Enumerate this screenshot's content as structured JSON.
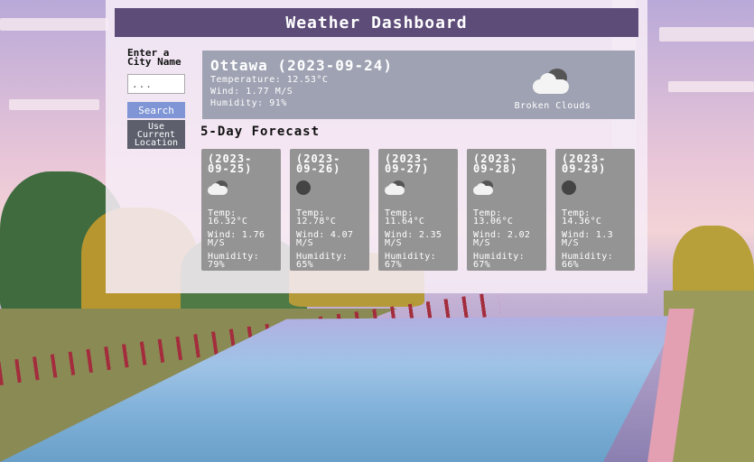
{
  "header": {
    "title": "Weather Dashboard"
  },
  "search": {
    "label": "Enter a City Name",
    "placeholder": "...",
    "search_button": "Search",
    "location_button": "Use Current Location"
  },
  "current": {
    "heading": "Ottawa (2023-09-24)",
    "temperature": "Temperature: 12.53°C",
    "wind": "Wind: 1.77 M/S",
    "humidity": "Humidity: 91%",
    "condition": "Broken Clouds",
    "icon": "clouds-icon"
  },
  "forecast": {
    "title": "5-Day Forecast",
    "days": [
      {
        "date": "(2023-09-25)",
        "icon": "clouds-icon",
        "temp": "Temp: 16.32°C",
        "wind": "Wind: 1.76 M/S",
        "humidity": "Humidity: 79%"
      },
      {
        "date": "(2023-09-26)",
        "icon": "moon-icon",
        "temp": "Temp: 12.78°C",
        "wind": "Wind: 4.07 M/S",
        "humidity": "Humidity: 65%"
      },
      {
        "date": "(2023-09-27)",
        "icon": "clouds-icon",
        "temp": "Temp: 11.64°C",
        "wind": "Wind: 2.35 M/S",
        "humidity": "Humidity: 67%"
      },
      {
        "date": "(2023-09-28)",
        "icon": "clouds-icon",
        "temp": "Temp: 13.06°C",
        "wind": "Wind: 2.02 M/S",
        "humidity": "Humidity: 67%"
      },
      {
        "date": "(2023-09-29)",
        "icon": "moon-icon",
        "temp": "Temp: 14.36°C",
        "wind": "Wind: 1.3 M/S",
        "humidity": "Humidity: 66%"
      }
    ]
  },
  "colors": {
    "header_bg": "#5d4c78",
    "current_bg": "#9ea2b2",
    "card_bg": "#949494",
    "search_button": "#7f95d6",
    "location_button": "#5d5f6c"
  }
}
